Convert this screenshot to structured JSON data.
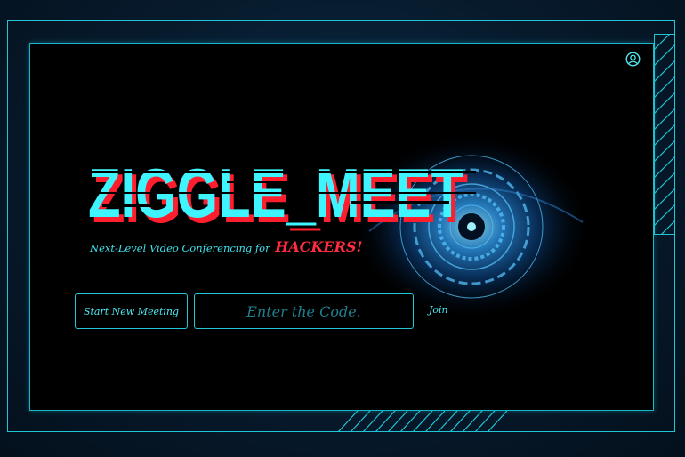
{
  "app": {
    "logo_text": "ZIGGLE_MEET",
    "tagline": "Next-Level Video Conferencing for",
    "tagline_highlight": "HACKERS!"
  },
  "actions": {
    "start_meeting_label": "Start New Meeting",
    "code_input_value": "",
    "code_input_placeholder": "Enter the Code.",
    "join_label": "Join"
  },
  "icons": {
    "profile": "user-circle-icon",
    "eye": "cyber-eye-icon"
  },
  "colors": {
    "accent": "#1fc6d6",
    "text_cyan": "#4fe9f2",
    "logo_cyan": "#3df4ff",
    "logo_red": "#ff1e2d",
    "panel_bg": "#000000",
    "page_bg": "#071a2c"
  }
}
